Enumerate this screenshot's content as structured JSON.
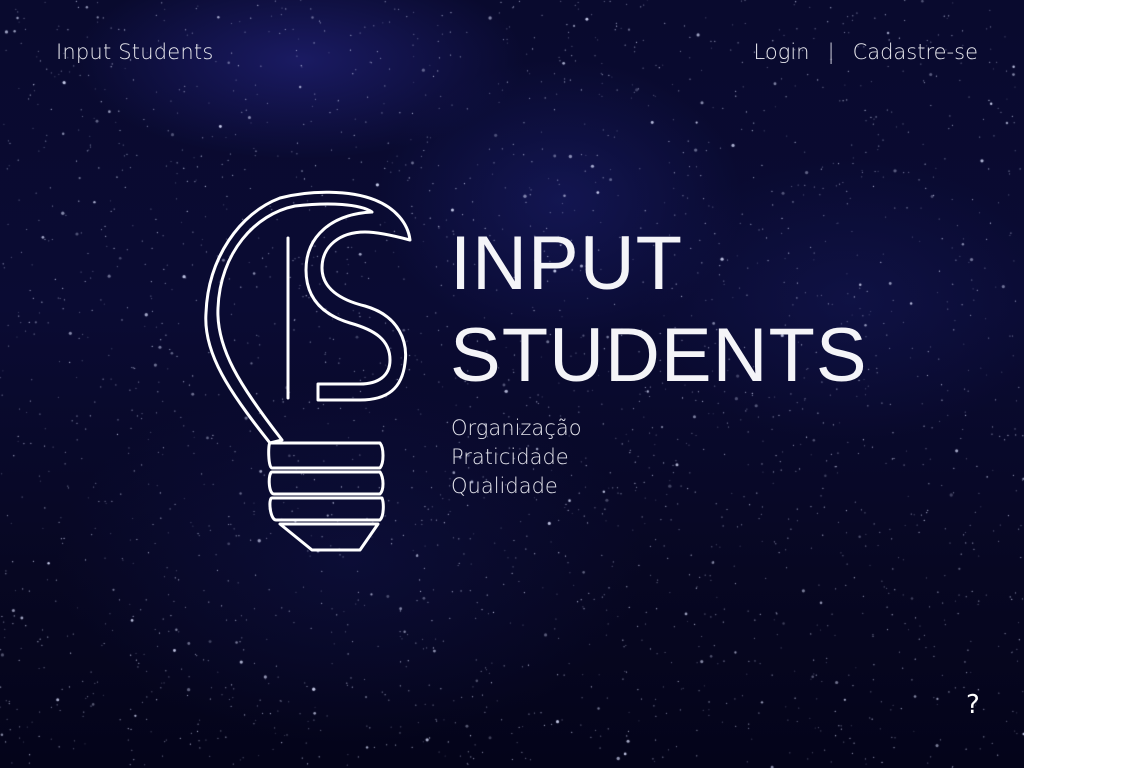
{
  "nav": {
    "brand": "Input Students",
    "login": "Login",
    "separator": "|",
    "signup": "Cadastre-se"
  },
  "hero": {
    "title_line1": "INPUT",
    "title_line2": "STUDENTS",
    "taglines": [
      "Organização",
      "Praticidade",
      "Qualidade"
    ]
  },
  "help": {
    "label": "?"
  },
  "colors": {
    "background": "#090a2e",
    "text": "#e8e8ee",
    "logo_stroke": "#ffffff"
  },
  "icons": {
    "logo": "lightbulb-icon"
  }
}
